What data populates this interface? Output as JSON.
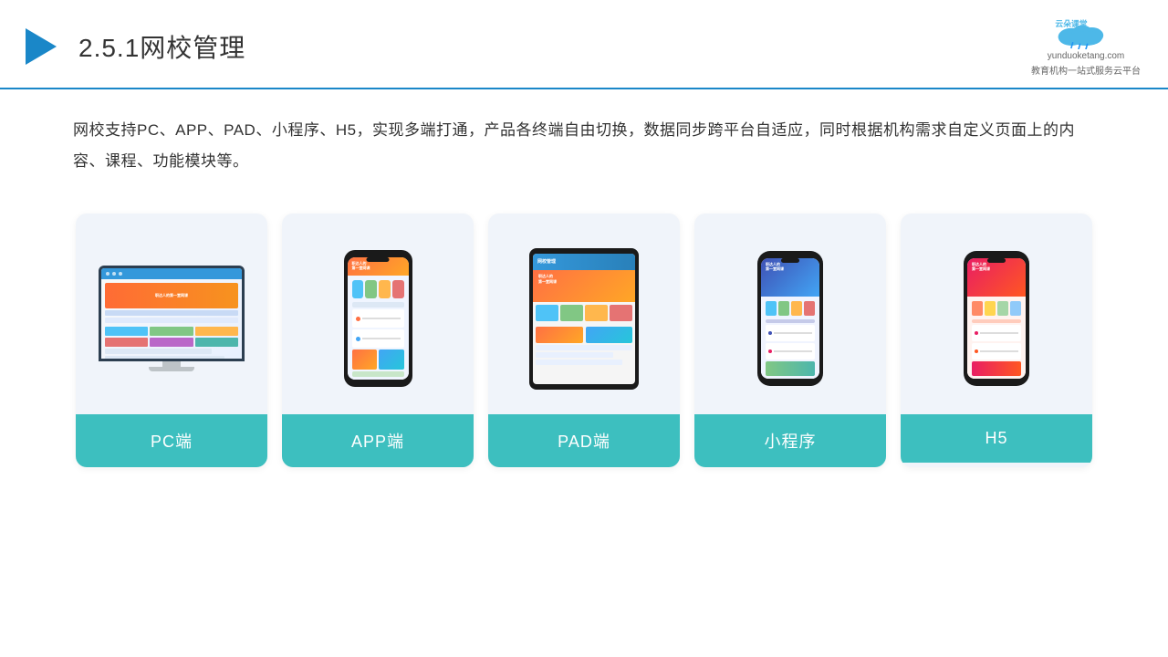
{
  "header": {
    "section": "2.5.1",
    "title": "网校管理",
    "brand_name": "云朵课堂",
    "brand_url": "yunduoketang.com",
    "brand_tagline": "教育机构一站式服务云平台"
  },
  "description": {
    "text": "网校支持PC、APP、PAD、小程序、H5，实现多端打通，产品各终端自由切换，数据同步跨平台自适应，同时根据机构需求自定义页面上的内容、课程、功能模块等。"
  },
  "cards": [
    {
      "id": "pc",
      "label": "PC端"
    },
    {
      "id": "app",
      "label": "APP端"
    },
    {
      "id": "pad",
      "label": "PAD端"
    },
    {
      "id": "miniprogram",
      "label": "小程序"
    },
    {
      "id": "h5",
      "label": "H5"
    }
  ],
  "colors": {
    "teal": "#3dbfbf",
    "blue": "#1a87c8",
    "card_bg": "#eef2f9"
  }
}
